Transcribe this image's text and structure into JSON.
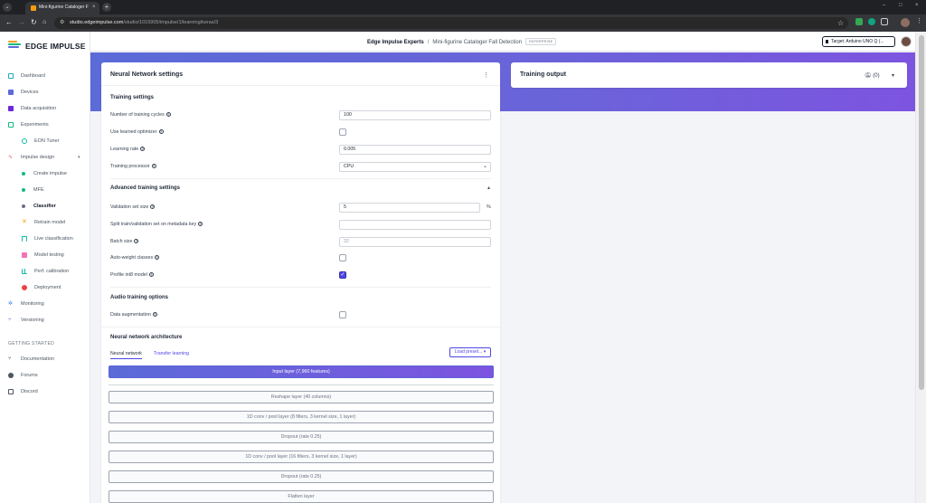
{
  "browser": {
    "tab_title": "Mini-figurine Cataloger Fall De",
    "url_host": "studio.edgeimpulse.com",
    "url_path": "/studio/1015905/impulse/1/learning/keras/3"
  },
  "brand": {
    "name": "EDGE IMPULSE",
    "accent": "#5b6bd8"
  },
  "header": {
    "project_owner": "Edge Impulse Experts",
    "separator": "/",
    "project_name": "Mini-figurine Cataloger Fall Detection",
    "badge": "ENTERPRISE",
    "target_label": "Target: Arduino UNO Q (..."
  },
  "sidebar": {
    "items": [
      {
        "label": "Dashboard",
        "icon": "monitor-icon"
      },
      {
        "label": "Devices",
        "icon": "device-icon"
      },
      {
        "label": "Data acquisition",
        "icon": "database-icon"
      },
      {
        "label": "Experiments",
        "icon": "grid-icon"
      },
      {
        "label": "EON Tuner",
        "icon": "tuner-icon"
      },
      {
        "label": "Impulse design",
        "icon": "impulse-icon"
      },
      {
        "label": "Create impulse",
        "icon": "dot-icon"
      },
      {
        "label": "MFE",
        "icon": "dot-icon"
      },
      {
        "label": "Classifier",
        "icon": "dot-icon"
      },
      {
        "label": "Retrain model",
        "icon": "retrain-icon"
      },
      {
        "label": "Live classification",
        "icon": "live-icon"
      },
      {
        "label": "Model testing",
        "icon": "testing-icon"
      },
      {
        "label": "Perf. calibration",
        "icon": "calibration-icon"
      },
      {
        "label": "Deployment",
        "icon": "deploy-icon"
      },
      {
        "label": "Monitoring",
        "icon": "monitoring-icon"
      },
      {
        "label": "Versioning",
        "icon": "versioning-icon"
      }
    ],
    "section_label": "GETTING STARTED",
    "getting_started": [
      {
        "label": "Documentation",
        "icon": "docs-icon"
      },
      {
        "label": "Forums",
        "icon": "forums-icon"
      },
      {
        "label": "Discord",
        "icon": "discord-icon"
      }
    ]
  },
  "nn_settings": {
    "title": "Neural Network settings",
    "menu": "⋮",
    "training_header": "Training settings",
    "training_cycles_label": "Number of training cycles",
    "training_cycles_value": "100",
    "learned_optimizer_label": "Use learned optimizer",
    "learning_rate_label": "Learning rate",
    "learning_rate_value": "0.005",
    "processor_label": "Training processor",
    "processor_value": "CPU",
    "advanced_header": "Advanced training settings",
    "validation_label": "Validation set size",
    "validation_value": "5",
    "validation_unit": "%",
    "split_label": "Split train/validation set on metadata key",
    "split_value": "",
    "batch_label": "Batch size",
    "batch_value": "32",
    "auto_weight_label": "Auto-weight classes",
    "profile_int8_label": "Profile int8 model",
    "audio_header": "Audio training options",
    "augmentation_label": "Data augmentation",
    "architecture_header": "Neural network architecture",
    "tab_nn": "Neural network",
    "tab_transfer": "Transfer learning",
    "load_preset": "Load preset...",
    "layers": [
      "Input layer (7,960 features)",
      "Reshape layer (40 columns)",
      "1D conv / pool layer (8 filters, 3 kernel size, 1 layer)",
      "Dropout (rate 0.25)",
      "1D conv / pool layer (16 filters, 3 kernel size, 1 layer)",
      "Dropout (rate 0.25)",
      "Flatten layer"
    ]
  },
  "training_output": {
    "title": "Training output",
    "notifications": "(0)"
  }
}
